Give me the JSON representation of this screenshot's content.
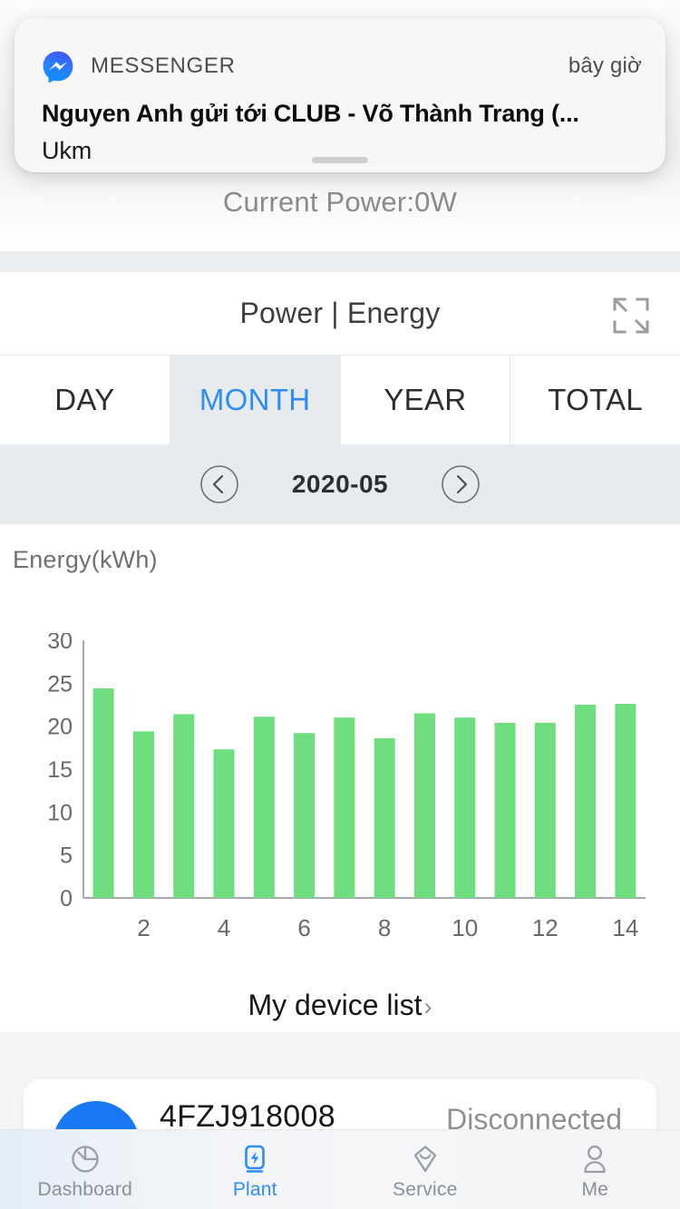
{
  "notification": {
    "app_name": "MESSENGER",
    "app_icon": "messenger-icon",
    "time": "bây giờ",
    "title": "Nguyen Anh gửi tới CLUB - Võ Thành Trang (...",
    "body": "Ukm",
    "accent": "#1877f2"
  },
  "status": {
    "current_power": "Current Power:0W"
  },
  "card": {
    "title": "Power | Energy",
    "expand_icon": "expand-fullscreen-icon",
    "tabs": [
      {
        "label": "DAY",
        "active": false
      },
      {
        "label": "MONTH",
        "active": true
      },
      {
        "label": "YEAR",
        "active": false
      },
      {
        "label": "TOTAL",
        "active": false
      }
    ],
    "active_tab_color": "#2e8df5",
    "period": {
      "prev_icon": "chevron-left-circle-icon",
      "next_icon": "chevron-right-circle-icon",
      "label": "2020-05"
    }
  },
  "chart_data": {
    "type": "bar",
    "title": "",
    "ylabel": "Energy(kWh)",
    "xlabel": "",
    "ylim": [
      0,
      30
    ],
    "yticks": [
      0,
      5,
      10,
      15,
      20,
      25,
      30
    ],
    "xticks": [
      2,
      4,
      6,
      8,
      10,
      12,
      14
    ],
    "grid": false,
    "legend": null,
    "bar_color": "#6fde7f",
    "categories": [
      1,
      2,
      3,
      4,
      5,
      6,
      7,
      8,
      9,
      10,
      11,
      12,
      13,
      14
    ],
    "values": [
      24.4,
      19.4,
      21.4,
      17.3,
      21.1,
      19.2,
      21.0,
      18.6,
      21.5,
      21.0,
      20.4,
      20.4,
      22.5,
      22.6
    ]
  },
  "device_list": {
    "link_label": "My device list",
    "chevron": "›"
  },
  "device": {
    "name": "4FZJ918008",
    "status": "Disconnected",
    "avatar_color": "#1877f2"
  },
  "bottom_nav": {
    "items": [
      {
        "label": "Dashboard",
        "icon": "dashboard-gauge-icon",
        "active": false
      },
      {
        "label": "Plant",
        "icon": "plant-battery-bolt-icon",
        "active": true
      },
      {
        "label": "Service",
        "icon": "service-diamond-smile-icon",
        "active": false
      },
      {
        "label": "Me",
        "icon": "person-icon",
        "active": false
      }
    ],
    "active_color": "#2e8df5",
    "inactive_color": "#8b9096"
  }
}
